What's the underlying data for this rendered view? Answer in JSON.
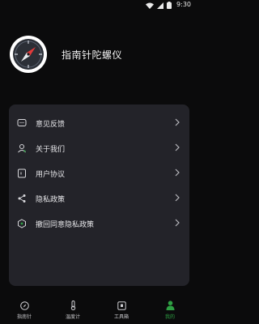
{
  "status_bar": {
    "time": "9:30",
    "icons": [
      "wifi-icon",
      "signal-icon",
      "battery-icon"
    ]
  },
  "profile": {
    "app_name": "指南针陀螺仪",
    "avatar_icon": "compass-icon"
  },
  "menu": {
    "items": [
      {
        "label": "意见反馈",
        "icon": "chat-icon"
      },
      {
        "label": "关于我们",
        "icon": "user-icon"
      },
      {
        "label": "用户协议",
        "icon": "document-icon"
      },
      {
        "label": "隐私政策",
        "icon": "share-icon"
      },
      {
        "label": "撤回同意隐私政策",
        "icon": "shield-icon"
      }
    ]
  },
  "tabs": [
    {
      "label": "指南针",
      "icon": "compass-icon",
      "active": false
    },
    {
      "label": "温度计",
      "icon": "thermometer-icon",
      "active": false
    },
    {
      "label": "工具箱",
      "icon": "toolbox-icon",
      "active": false
    },
    {
      "label": "我的",
      "icon": "profile-icon",
      "active": true
    }
  ],
  "colors": {
    "background": "#0b0b0c",
    "card": "#232329",
    "accent": "#2ea043",
    "text": "#e6e6e9"
  }
}
